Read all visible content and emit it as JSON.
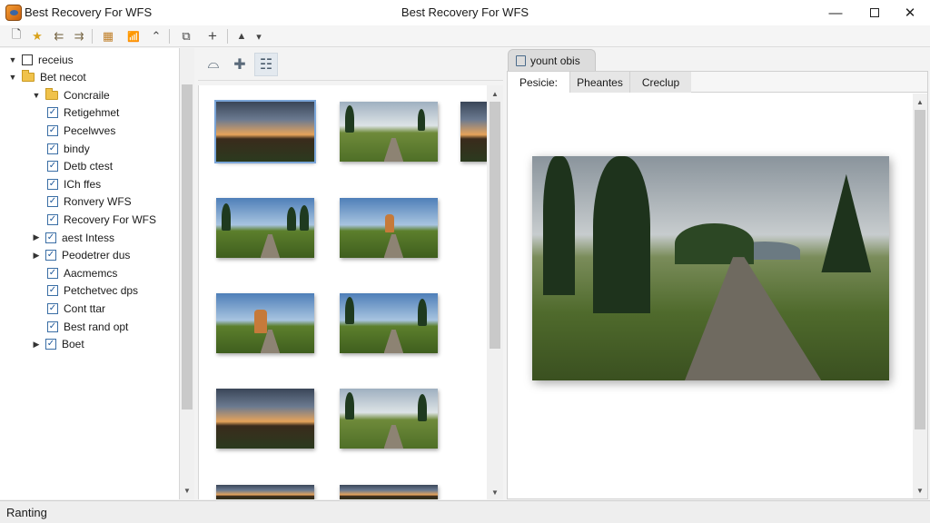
{
  "window": {
    "title_left": "Best Recovery For WFS",
    "title_center": "Best Recovery For WFS",
    "minimize_glyph": "—",
    "close_glyph": "✕"
  },
  "toolbar": {
    "icons": [
      "new-file-icon",
      "star-icon",
      "back-icon",
      "forward-icon",
      "layers-icon",
      "wifi-icon",
      "caret-up-icon",
      "compare-icon",
      "plus-icon",
      "triangle-icon",
      "dropdown-icon"
    ],
    "glyphs": {
      "new": "🗋",
      "star": "★",
      "back": "⇇",
      "forward": "⇉",
      "layers": "▦",
      "wifi": "📶",
      "caret": "⌃",
      "compare": "⧉",
      "plus": "+",
      "triangle": "▲",
      "dropdown": "▾"
    }
  },
  "tree": {
    "items": [
      {
        "label": "receius",
        "arrow": "▼",
        "checkbox": "empty",
        "indent": 0
      },
      {
        "label": "Bet necot",
        "arrow": "▼",
        "folder": true,
        "indent": 0
      },
      {
        "label": "Concraile",
        "arrow": "▼",
        "folder": true,
        "indent": 1
      },
      {
        "label": "Retigehmet",
        "checked": true,
        "indent": 1
      },
      {
        "label": "Pecelwves",
        "checked": true,
        "indent": 1
      },
      {
        "label": "bindy",
        "checked": true,
        "indent": 1
      },
      {
        "label": "Detb ctest",
        "checked": true,
        "indent": 1
      },
      {
        "label": "ICh ffes",
        "checked": true,
        "indent": 1
      },
      {
        "label": "Ronvery WFS",
        "checked": true,
        "indent": 1
      },
      {
        "label": "Recovery For WFS",
        "checked": true,
        "indent": 1
      },
      {
        "label": "aest Intess",
        "arrow": "▶",
        "checked": true,
        "indent": 1
      },
      {
        "label": "Peodetrer dus",
        "arrow": "▶",
        "checked": true,
        "indent": 1
      },
      {
        "label": "Aacmemcs",
        "checked": true,
        "indent": 1
      },
      {
        "label": "Petchetvec dps",
        "checked": true,
        "indent": 1
      },
      {
        "label": "Cont ttar",
        "checked": true,
        "indent": 1
      },
      {
        "label": "Best rand opt",
        "checked": true,
        "indent": 1
      },
      {
        "label": "Boet",
        "arrow": "▶",
        "checked": true,
        "indent": 1
      }
    ]
  },
  "middle_toolbar": {
    "icons": [
      "lasso-icon",
      "add-icon",
      "list-settings-icon"
    ],
    "glyphs": {
      "lasso": "⌓",
      "add": "✚",
      "list": "☷"
    }
  },
  "gallery": {
    "thumbnails": [
      {
        "type": "sunset",
        "selected": true
      },
      {
        "type": "road"
      },
      {
        "type": "sunset-partial"
      },
      {
        "type": "road2"
      },
      {
        "type": "road2-person"
      },
      {
        "type": "road2-person"
      },
      {
        "type": "road2"
      },
      {
        "type": "sunset"
      },
      {
        "type": "road"
      },
      {
        "type": "sunset-bottom"
      },
      {
        "type": "sunset-bottom"
      }
    ]
  },
  "preview": {
    "tab_label": "yount obis",
    "subtabs": [
      "Pesicie:",
      "Pheantes",
      "Creclup"
    ],
    "active_subtab": 0
  },
  "status": {
    "text": "Ranting"
  }
}
